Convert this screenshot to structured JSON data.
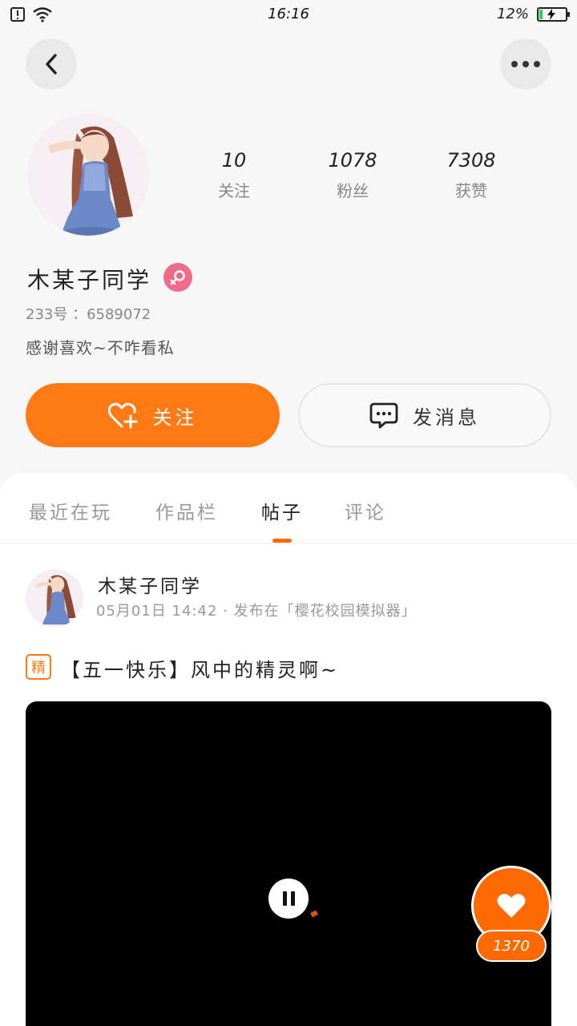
{
  "status_bar": {
    "time": "16:16",
    "battery_percent": "12%",
    "battery_level": 0.12
  },
  "profile": {
    "stats": [
      {
        "num": "10",
        "label": "关注"
      },
      {
        "num": "1078",
        "label": "粉丝"
      },
      {
        "num": "7308",
        "label": "获赞"
      }
    ],
    "nickname": "木某子同学",
    "uid": "233号 ：6589072",
    "bio": "感谢喜欢~不咋看私"
  },
  "actions": {
    "follow_label": "关注",
    "message_label": "发消息"
  },
  "tabs": [
    {
      "label": "最近在玩"
    },
    {
      "label": "作品栏"
    },
    {
      "label": "帖子"
    },
    {
      "label": "评论"
    }
  ],
  "post": {
    "author": "木某子同学",
    "meta": "05月01日 14:42 · 发布在「樱花校园模拟器」",
    "badge": "精",
    "title": "【五一快乐】风中的精灵啊~",
    "like_count": "1370"
  },
  "colors": {
    "accent": "#ff7a15",
    "gender_badge": "#f06a8a"
  }
}
